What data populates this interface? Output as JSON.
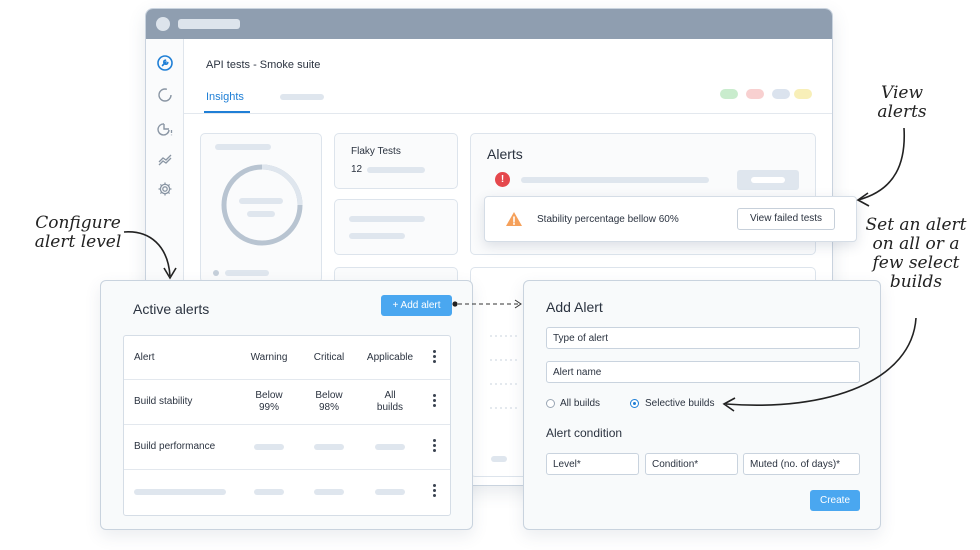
{
  "app": {
    "page_title": "API tests - Smoke suite",
    "tab_insights": "Insights",
    "status_pills": [
      "#c9eccd",
      "#f8d0d0",
      "#dbe3ee",
      "#f8efb8"
    ],
    "sidebar_icons": [
      "wrench-icon",
      "loading-ring-icon",
      "pie-alert-icon",
      "trend-icon",
      "gear-icon"
    ]
  },
  "flaky": {
    "title": "Flaky Tests",
    "value": "12"
  },
  "alerts_card": {
    "title": "Alerts"
  },
  "banner": {
    "text": "Stability percentage bellow 60%",
    "button": "View failed tests"
  },
  "active_alerts": {
    "title": "Active alerts",
    "add_button": "+ Add alert",
    "headers": [
      "Alert",
      "Warning",
      "Critical",
      "Applicable"
    ],
    "rows": [
      {
        "alert": "Build stability",
        "warning_1": "Below",
        "warning_2": "99%",
        "critical_1": "Below",
        "critical_2": "98%",
        "applicable_1": "All",
        "applicable_2": "builds"
      },
      {
        "alert": "Build performance"
      }
    ]
  },
  "add_alert": {
    "title": "Add Alert",
    "type_placeholder": "Type of alert",
    "name_placeholder": "Alert name",
    "radio_all": "All builds",
    "radio_selective": "Selective builds",
    "condition_title": "Alert condition",
    "level": "Level*",
    "condition": "Condition*",
    "muted": "Muted (no. of days)*",
    "create": "Create"
  },
  "annotations": {
    "configure": "Configure alert level",
    "view": "View alerts",
    "set": "Set an alert on all or a few select builds"
  }
}
